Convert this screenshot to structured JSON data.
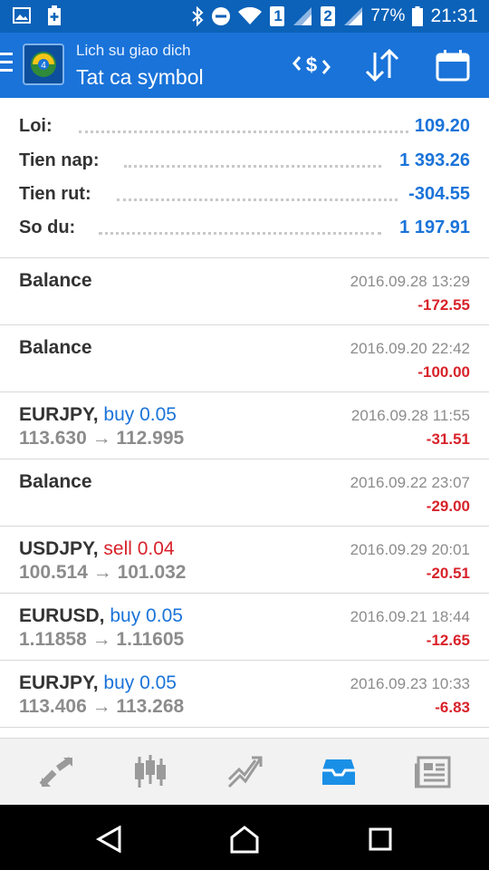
{
  "status_bar": {
    "sim1": "1",
    "sim2": "2",
    "battery": "77%",
    "time": "21:31"
  },
  "app_bar": {
    "subtitle": "Lich su giao dich",
    "title": "Tat ca symbol"
  },
  "summary": [
    {
      "label": "Loi:",
      "value": "109.20"
    },
    {
      "label": "Tien nap:",
      "value": "1 393.26"
    },
    {
      "label": "Tien rut:",
      "value": "-304.55"
    },
    {
      "label": "So du:",
      "value": "1 197.91"
    }
  ],
  "deals": [
    {
      "symbol": "Balance",
      "side": "",
      "prices": "",
      "time": "2016.09.28 13:29",
      "profit": "-172.55"
    },
    {
      "symbol": "Balance",
      "side": "",
      "prices": "",
      "time": "2016.09.20 22:42",
      "profit": "-100.00"
    },
    {
      "symbol": "EURJPY,",
      "side": "buy 0.05",
      "prices": "113.630 → 112.995",
      "time": "2016.09.28 11:55",
      "profit": "-31.51"
    },
    {
      "symbol": "Balance",
      "side": "",
      "prices": "",
      "time": "2016.09.22 23:07",
      "profit": "-29.00"
    },
    {
      "symbol": "USDJPY,",
      "side": "sell 0.04",
      "prices": "100.514 → 101.032",
      "time": "2016.09.29 20:01",
      "profit": "-20.51"
    },
    {
      "symbol": "EURUSD,",
      "side": "buy 0.05",
      "prices": "1.11858 → 1.11605",
      "time": "2016.09.21 18:44",
      "profit": "-12.65"
    },
    {
      "symbol": "EURJPY,",
      "side": "buy 0.05",
      "prices": "113.406 → 113.268",
      "time": "2016.09.23 10:33",
      "profit": "-6.83"
    }
  ],
  "colors": {
    "app_bar": "#1a73d9",
    "status_bar": "#0b62b8",
    "buy": "#1a73d9",
    "sell": "#d8222a",
    "active_tab": "#1a8fe6"
  },
  "bottom_nav": [
    "quotes-icon",
    "chart-icon",
    "trade-icon",
    "history-icon",
    "news-icon"
  ],
  "active_tab": "history-icon"
}
